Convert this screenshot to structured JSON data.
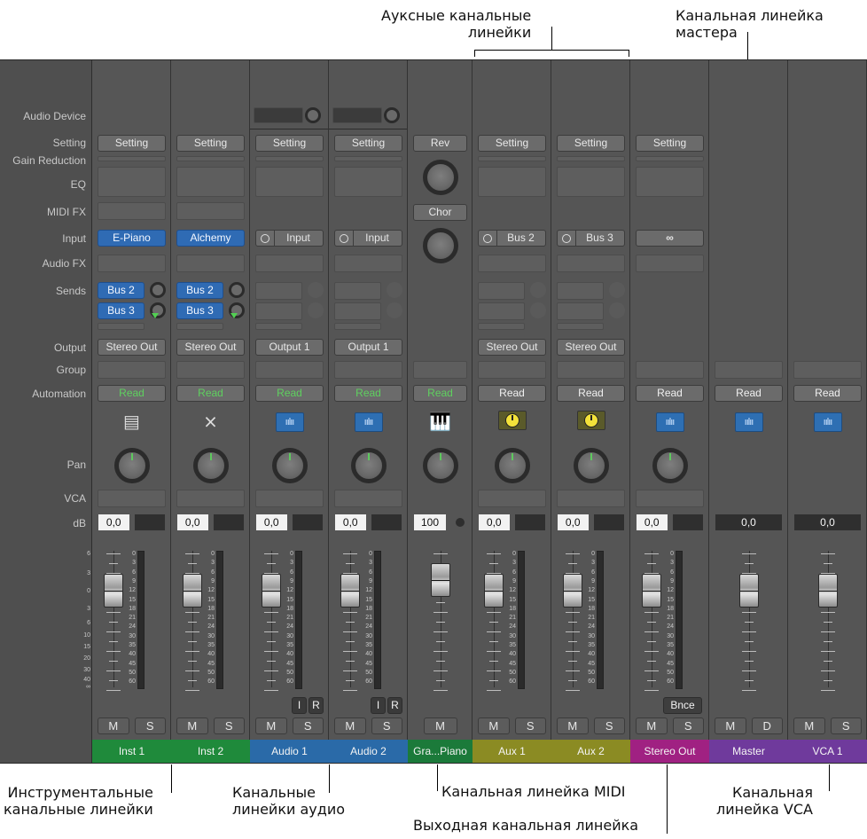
{
  "callouts": {
    "aux": [
      "Ауксные канальные",
      "линейки"
    ],
    "master": [
      "Канальная линейка",
      "мастера"
    ],
    "instrument": [
      "Инструментальные",
      "канальные линейки"
    ],
    "audio": [
      "Канальные",
      "линейки аудио"
    ],
    "midi": "Канальная линейка MIDI",
    "output": "Выходная канальная линейка",
    "vca": [
      "Канальная",
      "линейка VCA"
    ]
  },
  "row_labels": {
    "audio_device": "Audio Device",
    "setting": "Setting",
    "gain_reduction": "Gain Reduction",
    "eq": "EQ",
    "midi_fx": "MIDI FX",
    "input": "Input",
    "audio_fx": "Audio FX",
    "sends": "Sends",
    "output": "Output",
    "group": "Group",
    "automation": "Automation",
    "pan": "Pan",
    "vca": "VCA",
    "db": "dB"
  },
  "meter_scale": [
    "6",
    "3",
    "0",
    "3",
    "6",
    "10",
    "15",
    "20",
    "30",
    "40",
    "∞"
  ],
  "level_scale": [
    "0",
    "3",
    "6",
    "9",
    "12",
    "15",
    "18",
    "21",
    "24",
    "30",
    "35",
    "40",
    "45",
    "50",
    "60"
  ],
  "strips": [
    {
      "name": "Inst 1",
      "color": "#1f8a3b",
      "setting": "Setting",
      "input": "E-Piano",
      "send1": "Bus 2",
      "send2": "Bus 3",
      "output": "Stereo Out",
      "automation": "Read",
      "automation_color": "#5fd05f",
      "db": "0,0",
      "icon": "electric-piano-icon",
      "mute": "M",
      "solo": "S"
    },
    {
      "name": "Inst 2",
      "color": "#1f8a3b",
      "setting": "Setting",
      "input": "Alchemy",
      "send1": "Bus 2",
      "send2": "Bus 3",
      "output": "Stereo Out",
      "automation": "Read",
      "automation_color": "#5fd05f",
      "db": "0,0",
      "icon": "keyboard-stand-icon",
      "mute": "M",
      "solo": "S"
    },
    {
      "name": "Audio 1",
      "color": "#2a6aa8",
      "setting": "Setting",
      "input": "Input",
      "output": "Output 1",
      "automation": "Read",
      "automation_color": "#5fd05f",
      "db": "0,0",
      "icon": "waveform-icon",
      "icon_glyph": "ıılıı",
      "input_monitor": "I",
      "record": "R",
      "mute": "M",
      "solo": "S"
    },
    {
      "name": "Audio 2",
      "color": "#2a6aa8",
      "setting": "Setting",
      "input": "Input",
      "output": "Output 1",
      "automation": "Read",
      "automation_color": "#5fd05f",
      "db": "0,0",
      "icon": "waveform-icon",
      "icon_glyph": "ıılıı",
      "input_monitor": "I",
      "record": "R",
      "mute": "M",
      "solo": "S"
    },
    {
      "name": "Gra...Piano",
      "color": "#1b7a3a",
      "midi_fx_1": "Rev",
      "midi_fx_2": "Chor",
      "automation": "Read",
      "automation_color": "#5fd05f",
      "db": "100",
      "icon": "grand-piano-icon",
      "mute": "M"
    },
    {
      "name": "Aux 1",
      "color": "#8b8b23",
      "setting": "Setting",
      "input": "Bus 2",
      "output": "Stereo Out",
      "automation": "Read",
      "automation_color": "#f0f0f0",
      "db": "0,0",
      "icon": "aux-knob-icon",
      "mute": "M",
      "solo": "S"
    },
    {
      "name": "Aux 2",
      "color": "#8b8b23",
      "setting": "Setting",
      "input": "Bus 3",
      "output": "Stereo Out",
      "automation": "Read",
      "automation_color": "#f0f0f0",
      "db": "0,0",
      "icon": "aux-knob-icon",
      "mute": "M",
      "solo": "S"
    },
    {
      "name": "Stereo Out",
      "color": "#a02182",
      "setting": "Setting",
      "input": "∞",
      "automation": "Read",
      "automation_color": "#f0f0f0",
      "db": "0,0",
      "icon": "waveform-icon",
      "icon_glyph": "ıılıı",
      "bounce": "Bnce",
      "mute": "M",
      "solo": "S"
    },
    {
      "name": "Master",
      "color": "#6f3a9c",
      "automation": "Read",
      "automation_color": "#f0f0f0",
      "db": "0,0",
      "icon": "waveform-icon",
      "icon_glyph": "ıılıı",
      "mute": "M",
      "dim": "D"
    },
    {
      "name": "VCA 1",
      "color": "#6f3a9c",
      "automation": "Read",
      "automation_color": "#f0f0f0",
      "db": "0,0",
      "icon": "waveform-icon",
      "icon_glyph": "ıılıı",
      "mute": "M",
      "solo": "S"
    }
  ]
}
